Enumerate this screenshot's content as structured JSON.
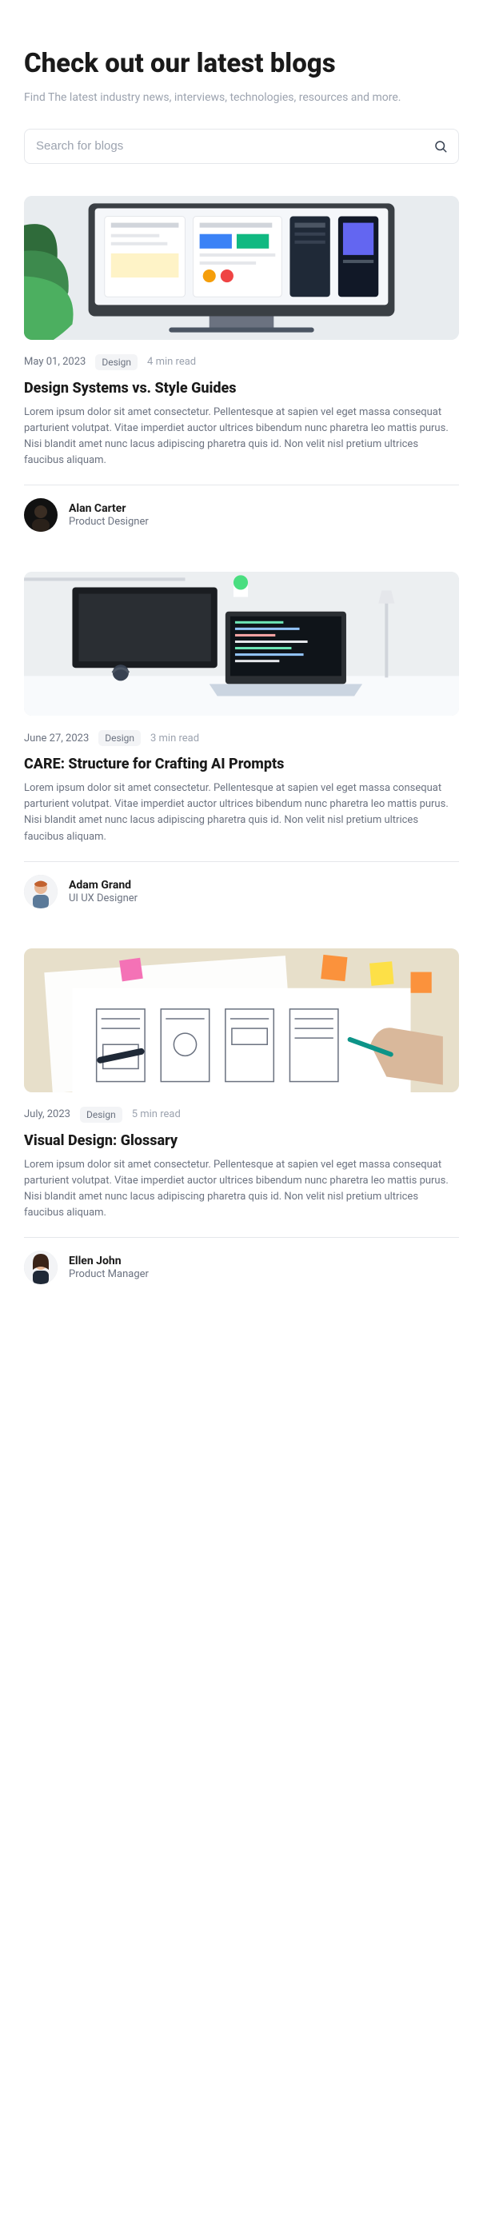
{
  "header": {
    "title": "Check out our latest blogs",
    "subtitle": "Find The latest industry news, interviews, technologies, resources and more."
  },
  "search": {
    "placeholder": "Search for blogs"
  },
  "posts": [
    {
      "date": "May 01, 2023",
      "tag": "Design",
      "read_time": "4 min read",
      "title": "Design Systems vs. Style Guides",
      "excerpt": "Lorem ipsum dolor sit amet consectetur. Pellentesque at sapien vel eget massa consequat parturient volutpat. Vitae imperdiet auctor ultrices bibendum nunc pharetra leo mattis purus. Nisi blandit amet nunc lacus adipiscing pharetra quis id. Non velit nisl pretium ultrices faucibus aliquam.",
      "author": {
        "name": "Alan Carter",
        "role": "Product Designer"
      }
    },
    {
      "date": "June 27, 2023",
      "tag": "Design",
      "read_time": "3 min read",
      "title": "CARE: Structure for Crafting AI Prompts",
      "excerpt": "Lorem ipsum dolor sit amet consectetur. Pellentesque at sapien vel eget massa consequat parturient volutpat. Vitae imperdiet auctor ultrices bibendum nunc pharetra leo mattis purus. Nisi blandit amet nunc lacus adipiscing pharetra quis id. Non velit nisl pretium ultrices faucibus aliquam.",
      "author": {
        "name": "Adam Grand",
        "role": "UI UX Designer"
      }
    },
    {
      "date": "July, 2023",
      "tag": "Design",
      "read_time": "5 min read",
      "title": "Visual Design: Glossary",
      "excerpt": "Lorem ipsum dolor sit amet consectetur. Pellentesque at sapien vel eget massa consequat parturient volutpat. Vitae imperdiet auctor ultrices bibendum nunc pharetra leo mattis purus. Nisi blandit amet nunc lacus adipiscing pharetra quis id. Non velit nisl pretium ultrices faucibus aliquam.",
      "author": {
        "name": "Ellen John",
        "role": "Product Manager"
      }
    }
  ]
}
